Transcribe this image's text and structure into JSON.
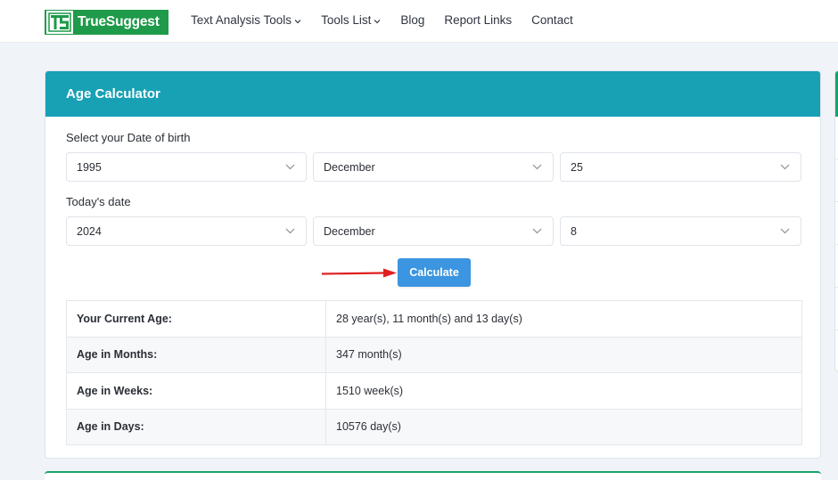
{
  "navbar": {
    "logo": {
      "mark": "TS",
      "text": "TrueSuggest",
      "color": "#1e9a4a"
    },
    "links": [
      {
        "label": "Text Analysis Tools",
        "dropdown": true
      },
      {
        "label": "Tools List",
        "dropdown": true
      },
      {
        "label": "Blog",
        "dropdown": false
      },
      {
        "label": "Report Links",
        "dropdown": false
      },
      {
        "label": "Contact",
        "dropdown": false
      }
    ]
  },
  "calculator": {
    "title": "Age Calculator",
    "header_color": "#18a1b5",
    "dob_label": "Select your Date of birth",
    "dob": {
      "year": "1995",
      "month": "December",
      "day": "25"
    },
    "today_label": "Today's date",
    "today": {
      "year": "2024",
      "month": "December",
      "day": "8"
    },
    "calculate_label": "Calculate",
    "button_color": "#3b95e0",
    "annotation_arrow_color": "#e02020",
    "results": [
      {
        "label": "Your Current Age:",
        "value": "28 year(s), 11 month(s) and 13 day(s)"
      },
      {
        "label": "Age in Months:",
        "value": "347 month(s)"
      },
      {
        "label": "Age in Weeks:",
        "value": "1510 week(s)"
      },
      {
        "label": "Age in Days:",
        "value": "10576 day(s)"
      }
    ]
  }
}
